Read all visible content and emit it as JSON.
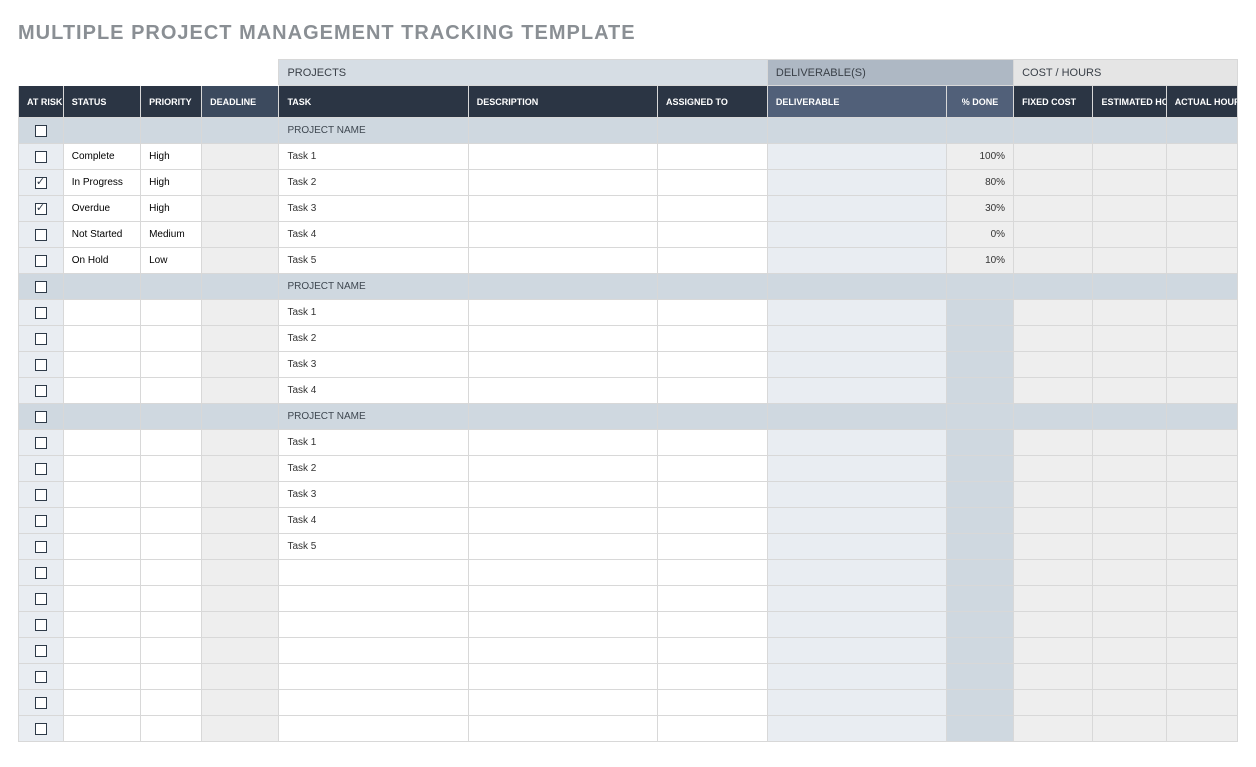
{
  "title": "MULTIPLE PROJECT MANAGEMENT TRACKING TEMPLATE",
  "groupHeaders": {
    "projects": "PROJECTS",
    "deliverables": "DELIVERABLE(S)",
    "cost": "COST / HOURS"
  },
  "columns": {
    "atRisk": "AT RISK",
    "status": "STATUS",
    "priority": "PRIORITY",
    "deadline": "DEADLINE",
    "task": "TASK",
    "description": "DESCRIPTION",
    "assignedTo": "ASSIGNED TO",
    "deliverable": "DELIVERABLE",
    "percentDone": "% DONE",
    "fixedCost": "FIXED COST",
    "estimatedHours": "ESTIMATED HOURS",
    "actualHours": "ACTUAL HOURS"
  },
  "statusColors": {
    "Complete": "#1fb254",
    "In Progress": "#75c04a",
    "Overdue": "#f3cc3a",
    "Not Started": "#f5f2e6",
    "On Hold": "#d6dde4"
  },
  "priorityColors": {
    "High": "#ff1f1f",
    "Medium": "#f9b500",
    "Low": "#8ee8f4"
  },
  "rows": [
    {
      "type": "section",
      "task": "PROJECT NAME"
    },
    {
      "type": "task",
      "atRisk": false,
      "status": "Complete",
      "priority": "High",
      "task": "Task 1",
      "percentDone": "100%"
    },
    {
      "type": "task",
      "atRisk": true,
      "status": "In Progress",
      "priority": "High",
      "task": "Task 2",
      "percentDone": "80%"
    },
    {
      "type": "task",
      "atRisk": true,
      "status": "Overdue",
      "priority": "High",
      "task": "Task 3",
      "percentDone": "30%"
    },
    {
      "type": "task",
      "atRisk": false,
      "status": "Not Started",
      "priority": "Medium",
      "task": "Task 4",
      "percentDone": "0%"
    },
    {
      "type": "task",
      "atRisk": false,
      "status": "On Hold",
      "priority": "Low",
      "task": "Task 5",
      "percentDone": "10%"
    },
    {
      "type": "section",
      "task": "PROJECT NAME"
    },
    {
      "type": "task",
      "atRisk": false,
      "task": "Task 1"
    },
    {
      "type": "task",
      "atRisk": false,
      "task": "Task 2"
    },
    {
      "type": "task",
      "atRisk": false,
      "task": "Task 3"
    },
    {
      "type": "task",
      "atRisk": false,
      "task": "Task 4"
    },
    {
      "type": "section",
      "task": "PROJECT NAME"
    },
    {
      "type": "task",
      "atRisk": false,
      "task": "Task 1"
    },
    {
      "type": "task",
      "atRisk": false,
      "task": "Task 2"
    },
    {
      "type": "task",
      "atRisk": false,
      "task": "Task 3"
    },
    {
      "type": "task",
      "atRisk": false,
      "task": "Task 4"
    },
    {
      "type": "task",
      "atRisk": false,
      "task": "Task 5"
    },
    {
      "type": "task",
      "atRisk": false
    },
    {
      "type": "task",
      "atRisk": false
    },
    {
      "type": "task",
      "atRisk": false
    },
    {
      "type": "task",
      "atRisk": false
    },
    {
      "type": "task",
      "atRisk": false
    },
    {
      "type": "task",
      "atRisk": false
    },
    {
      "type": "task",
      "atRisk": false
    }
  ]
}
